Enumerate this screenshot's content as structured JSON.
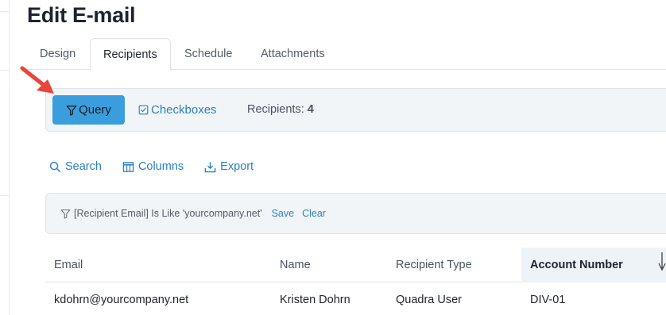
{
  "page": {
    "title": "Edit E-mail"
  },
  "tabs": [
    {
      "label": "Design",
      "active": false
    },
    {
      "label": "Recipients",
      "active": true
    },
    {
      "label": "Schedule",
      "active": false
    },
    {
      "label": "Attachments",
      "active": false
    }
  ],
  "toolbar": {
    "query_label": "Query",
    "checkboxes_label": "Checkboxes",
    "recipients_label": "Recipients:",
    "recipients_count": "4"
  },
  "actions": {
    "search_label": "Search",
    "columns_label": "Columns",
    "export_label": "Export"
  },
  "filter": {
    "text": "[Recipient Email] Is Like 'yourcompany.net'",
    "save_label": "Save",
    "clear_label": "Clear"
  },
  "table": {
    "columns": [
      "Email",
      "Name",
      "Recipient Type",
      "Account Number"
    ],
    "sorted_column": "Account Number",
    "rows": [
      {
        "email": "kdohrn@yourcompany.net",
        "name": "Kristen Dohrn",
        "type": "Quadra User",
        "account": "DIV-01"
      }
    ]
  },
  "colors": {
    "accent": "#3a9ede",
    "link": "#2b7fc4",
    "annotation_arrow": "#e8463a"
  },
  "icons": [
    "filter-icon",
    "checkbox-icon",
    "search-icon",
    "columns-icon",
    "export-icon",
    "annotation-arrow",
    "resize-cursor"
  ]
}
